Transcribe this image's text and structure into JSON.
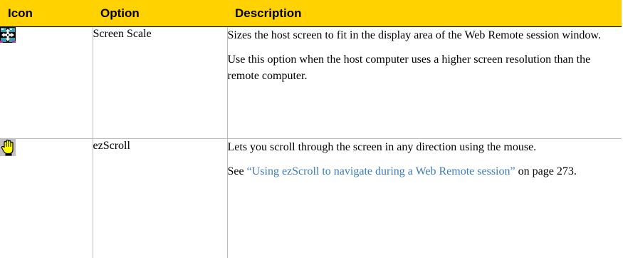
{
  "table": {
    "headers": {
      "icon": "Icon",
      "option": "Option",
      "description": "Description"
    },
    "rows": [
      {
        "icon_name": "screen-scale-icon",
        "option": "Screen Scale",
        "paragraphs": [
          "Sizes the host screen to fit in the display area of the Web Remote session window.",
          "Use this option when the host computer uses a higher screen resolution than the remote computer."
        ]
      },
      {
        "icon_name": "ezscroll-hand-icon",
        "option": "ezScroll",
        "paragraphs": [
          "Lets you scroll through the screen in any direction using the mouse."
        ],
        "see_prefix": "See ",
        "see_link": "“Using ezScroll to navigate during a Web Remote session”",
        "see_suffix": " on page 273."
      }
    ]
  },
  "colors": {
    "header_background": "#ffd200",
    "link": "#3b7dbf",
    "row_divider": "#bdbdbd"
  }
}
